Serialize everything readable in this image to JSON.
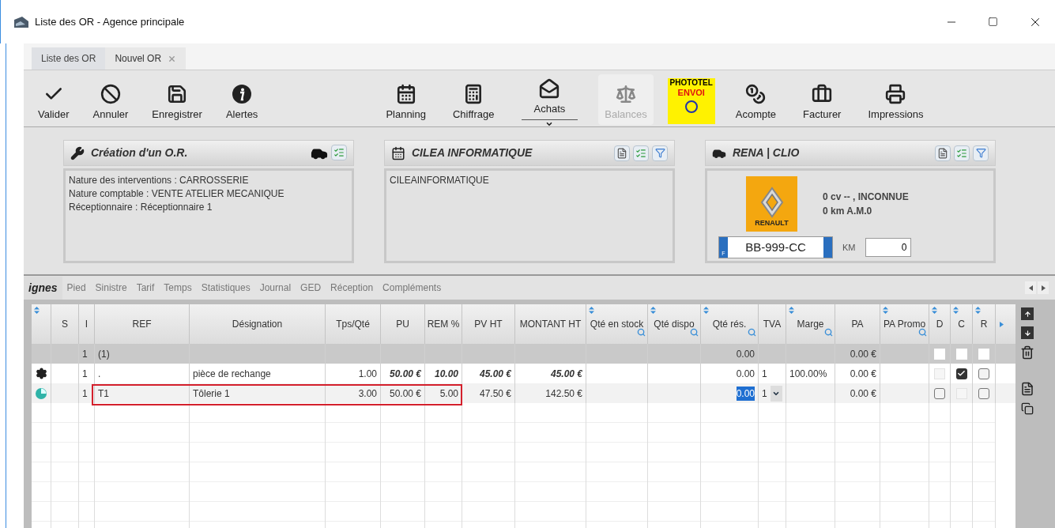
{
  "window": {
    "title": "Liste des OR - Agence principale"
  },
  "doc_tabs": [
    {
      "label": "Liste des OR",
      "selected": false,
      "closable": false
    },
    {
      "label": "Nouvel OR",
      "selected": true,
      "closable": true
    }
  ],
  "toolbar": {
    "left": [
      {
        "label": "Valider",
        "disabled": false,
        "dropdown": false
      },
      {
        "label": "Annuler",
        "disabled": false,
        "dropdown": false
      },
      {
        "label": "Enregistrer",
        "disabled": false,
        "dropdown": false
      },
      {
        "label": "Alertes",
        "disabled": false,
        "dropdown": false
      }
    ],
    "right": [
      {
        "kind": "button",
        "label": "Planning",
        "disabled": false,
        "dropdown": false
      },
      {
        "kind": "button",
        "label": "Chiffrage",
        "disabled": false,
        "dropdown": false
      },
      {
        "kind": "button",
        "label": "Achats",
        "disabled": false,
        "dropdown": true
      },
      {
        "kind": "button",
        "label": "Balances",
        "disabled": true,
        "dropdown": false
      },
      {
        "kind": "logo",
        "lines": [
          "PHOTOTEL",
          "ENVOI"
        ]
      },
      {
        "kind": "button",
        "label": "Acompte",
        "disabled": false,
        "dropdown": false
      },
      {
        "kind": "button",
        "label": "Facturer",
        "disabled": false,
        "dropdown": false
      },
      {
        "kind": "button",
        "label": "Impressions",
        "disabled": false,
        "dropdown": false
      }
    ]
  },
  "panels": [
    {
      "kind": "order",
      "title": "Création d'un O.R.",
      "lines": [
        "Nature des interventions : CARROSSERIE",
        "Nature comptable : VENTE ATELIER MECANIQUE",
        "Réceptionnaire  : Réceptionnaire 1"
      ]
    },
    {
      "kind": "client",
      "title": "CILEA INFORMATIQUE",
      "lines": [
        "CILEAINFORMATIQUE"
      ]
    },
    {
      "kind": "vehicle",
      "title": "RENA | CLIO",
      "brand": "RENAULT",
      "lines": [
        "0 cv -- , INCONNUE",
        "0 km  A.M.0"
      ],
      "plate": "BB-999-CC",
      "plate_country": "F",
      "km_label": "KM",
      "km_value": "0"
    }
  ],
  "detail_tabs": [
    {
      "label": "ignes",
      "selected": true
    },
    {
      "label": "Pied",
      "selected": false
    },
    {
      "label": "Sinistre",
      "selected": false
    },
    {
      "label": "Tarif",
      "selected": false
    },
    {
      "label": "Temps",
      "selected": false
    },
    {
      "label": "Statistiques",
      "selected": false
    },
    {
      "label": "Journal",
      "selected": false
    },
    {
      "label": "GED",
      "selected": false
    },
    {
      "label": "Réception",
      "selected": false
    },
    {
      "label": "Compléments",
      "selected": false
    }
  ],
  "table": {
    "columns": [
      {
        "sort": true,
        "search": false
      },
      {
        "label": "S",
        "sort": false,
        "search": false
      },
      {
        "label": "I",
        "sort": false,
        "search": false
      },
      {
        "label": "REF",
        "sort": false,
        "search": false
      },
      {
        "label": "Désignation",
        "sort": false,
        "search": false
      },
      {
        "label": "Tps/Qté",
        "sort": false,
        "search": false
      },
      {
        "label": "PU",
        "sort": false,
        "search": false
      },
      {
        "label": "REM %",
        "sort": false,
        "search": false
      },
      {
        "label": "PV HT",
        "sort": false,
        "search": false
      },
      {
        "label": "MONTANT HT",
        "sort": false,
        "search": false
      },
      {
        "label": "Qté en stock",
        "sort": true,
        "search": true
      },
      {
        "label": "Qté dispo",
        "sort": true,
        "search": true
      },
      {
        "label": "Qté rés.",
        "sort": true,
        "search": true
      },
      {
        "label": "TVA",
        "sort": false,
        "search": false
      },
      {
        "label": "Marge",
        "sort": true,
        "search": true
      },
      {
        "label": "PA",
        "sort": false,
        "search": false
      },
      {
        "label": "PA Promo",
        "sort": true,
        "search": true
      },
      {
        "label": "D",
        "sort": true,
        "search": false
      },
      {
        "label": "C",
        "sort": true,
        "search": false
      },
      {
        "label": "R",
        "sort": true,
        "search": false
      }
    ],
    "rows": [
      {
        "kind": "group",
        "outlined": false,
        "dropdown": false,
        "cells": [
          "",
          "",
          {
            "text": "1",
            "bold": false,
            "selected": false
          },
          {
            "text": "(1)",
            "bold": false,
            "selected": false
          },
          "",
          "",
          "",
          "",
          "",
          "",
          "",
          "",
          {
            "text": "0.00",
            "bold": false,
            "selected": false
          },
          "",
          "",
          {
            "text": "0.00 €",
            "bold": false,
            "selected": false
          },
          ""
        ],
        "checks": [
          {
            "kind": "plain",
            "checked": false
          },
          {
            "kind": "plain",
            "checked": false
          },
          {
            "kind": "plain",
            "checked": false
          }
        ]
      },
      {
        "kind": "part",
        "outlined": false,
        "dropdown": false,
        "cells": [
          "",
          "",
          {
            "text": "1",
            "bold": false,
            "selected": false
          },
          {
            "text": ".",
            "bold": false,
            "selected": false
          },
          {
            "text": "pièce de rechange",
            "bold": false,
            "selected": false
          },
          {
            "text": "1.00",
            "bold": false,
            "selected": false
          },
          {
            "text": "50.00 €",
            "bold": true,
            "selected": false
          },
          {
            "text": "10.00",
            "bold": true,
            "selected": false
          },
          {
            "text": "45.00 €",
            "bold": true,
            "selected": false
          },
          {
            "text": "45.00 €",
            "bold": true,
            "selected": false
          },
          "",
          "",
          {
            "text": "0.00",
            "bold": false,
            "selected": false
          },
          {
            "text": "1",
            "bold": false,
            "selected": false
          },
          {
            "text": "100.00%",
            "bold": false,
            "selected": false
          },
          {
            "text": "0.00 €",
            "bold": false,
            "selected": false
          },
          ""
        ],
        "checks": [
          {
            "kind": "blank"
          },
          {
            "kind": "box",
            "checked": true
          },
          {
            "kind": "box",
            "checked": false
          }
        ]
      },
      {
        "kind": "labor",
        "outlined": true,
        "dropdown": true,
        "cells": [
          "",
          "",
          {
            "text": "1",
            "bold": false,
            "selected": false
          },
          {
            "text": "T1",
            "bold": false,
            "selected": false
          },
          {
            "text": "Tôlerie 1",
            "bold": false,
            "selected": false
          },
          {
            "text": "3.00",
            "bold": false,
            "selected": false
          },
          {
            "text": "50.00 €",
            "bold": false,
            "selected": false
          },
          {
            "text": "5.00",
            "bold": false,
            "selected": false
          },
          {
            "text": "47.50 €",
            "bold": false,
            "selected": false
          },
          {
            "text": "142.50 €",
            "bold": false,
            "selected": false
          },
          "",
          "",
          {
            "text": "0.00",
            "bold": false,
            "selected": true
          },
          {
            "text": "1",
            "bold": false,
            "selected": false
          },
          "",
          {
            "text": "0.00 €",
            "bold": false,
            "selected": false
          },
          ""
        ],
        "checks": [
          {
            "kind": "box",
            "checked": false
          },
          {
            "kind": "blank"
          },
          {
            "kind": "box",
            "checked": false
          }
        ]
      }
    ]
  }
}
